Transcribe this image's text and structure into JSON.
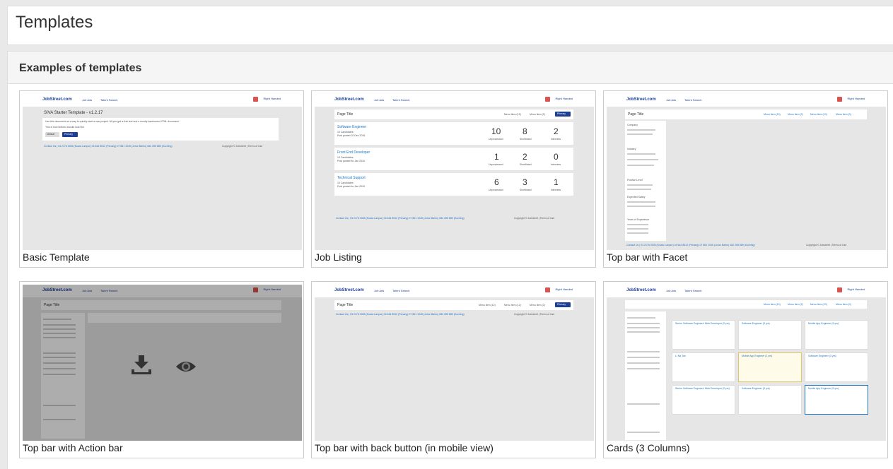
{
  "page": {
    "title": "Templates"
  },
  "section": {
    "title": "Examples of templates"
  },
  "mini": {
    "logo": "JobStreet.com",
    "nav_job_ads": "Job Ads",
    "nav_talent_search": "Talent Search",
    "user": "Right Handed",
    "page_title": "Page Title",
    "primary": "Primary"
  },
  "basic": {
    "heading": "SIVA Starter Template - v1.2.17",
    "line1": "Use this document as a way to quickly start a new project. All you get is this text and a mostly barebones HTML document.",
    "line2": "This is how buttons should look like.",
    "btn_default": "Default",
    "btn_primary": "Primary",
    "footer": "Contact Us | 03 2176 0035 (Kuala Lumpur)  04 644 8512 (Penang)  07 861 1045 (Johor Bahru)  082 255 889 (Kuching)",
    "copyright": "Copyright © Jobstreet | Terms of Use"
  },
  "joblisting": {
    "tab1": "Menu Item (12)",
    "tab2": "Menu Item (2)",
    "jobs": [
      {
        "title": "Software Engineer",
        "meta": "10 Candidates",
        "posted": "Post posted 02 Dec 2016",
        "n1": "10",
        "n2": "8",
        "n3": "2"
      },
      {
        "title": "Front End Developer",
        "meta": "10 Candidates",
        "posted": "Post posted for Jan 2016",
        "n1": "1",
        "n2": "2",
        "n3": "0"
      },
      {
        "title": "Technical Support",
        "meta": "10 Candidates",
        "posted": "Post posted for Jan 2015",
        "n1": "6",
        "n2": "3",
        "n3": "1"
      }
    ],
    "col1": "Unprocessed",
    "col2": "Shortlisted",
    "col3": "Interview"
  },
  "facet": {
    "tabs": [
      "Menu Item (10)",
      "Menu Item (2)",
      "Menu Item (10)",
      "Menu Item (0)"
    ],
    "groups": [
      "Company",
      "Industry",
      "Position Level",
      "Expected Salary",
      "Years of Experience"
    ]
  },
  "cards": [
    {
      "label": "Basic Template"
    },
    {
      "label": "Job Listing"
    },
    {
      "label": "Top bar with Facet"
    },
    {
      "label": "Top bar with Action bar"
    },
    {
      "label": "Top bar with back button (in mobile view)"
    },
    {
      "label": "Cards (3 Columns)"
    }
  ],
  "actionbar": {
    "download_icon": "download-icon",
    "preview_icon": "eye-icon"
  },
  "threecol": {
    "cards": [
      "Senior Software Engineer/ Web Developer (2 yrs)",
      "Software Engineer (3 yrs)",
      "Mobile App Engineer (5 yrs)",
      "Li Na Tan",
      "Mobile App Engineer (1 yrs)",
      "Software Engineer (3 yrs)",
      "Senior Software Engineer/ Web Developer (2 yrs)",
      "Software Engineer (3 yrs)",
      "Mobile App Engineer (5 yrs)"
    ]
  }
}
